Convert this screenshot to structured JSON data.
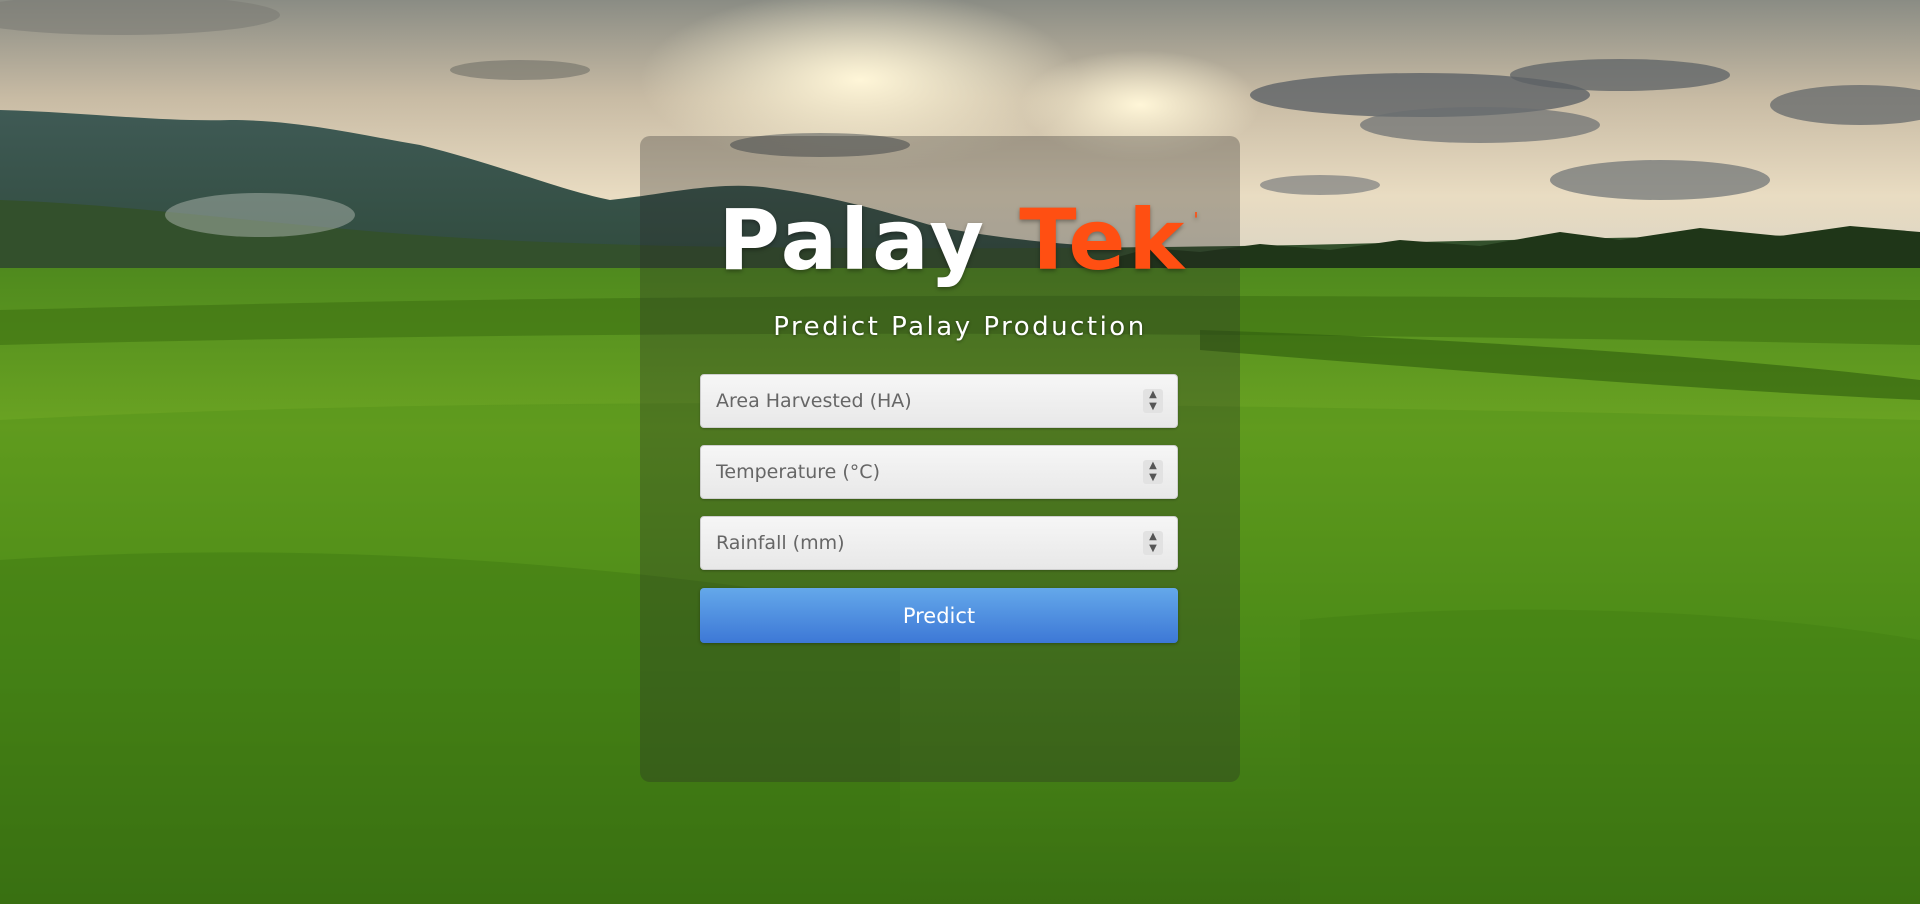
{
  "brand": {
    "word1": "Palay",
    "word2": "Tek",
    "mark": "'"
  },
  "subtitle": "Predict Palay Production",
  "form": {
    "area_placeholder": "Area Harvested (HA)",
    "temperature_placeholder": "Temperature (°C)",
    "rainfall_placeholder": "Rainfall (mm)",
    "predict_label": "Predict"
  },
  "colors": {
    "accent": "#ff4f12",
    "button": "#4a8ae0"
  }
}
